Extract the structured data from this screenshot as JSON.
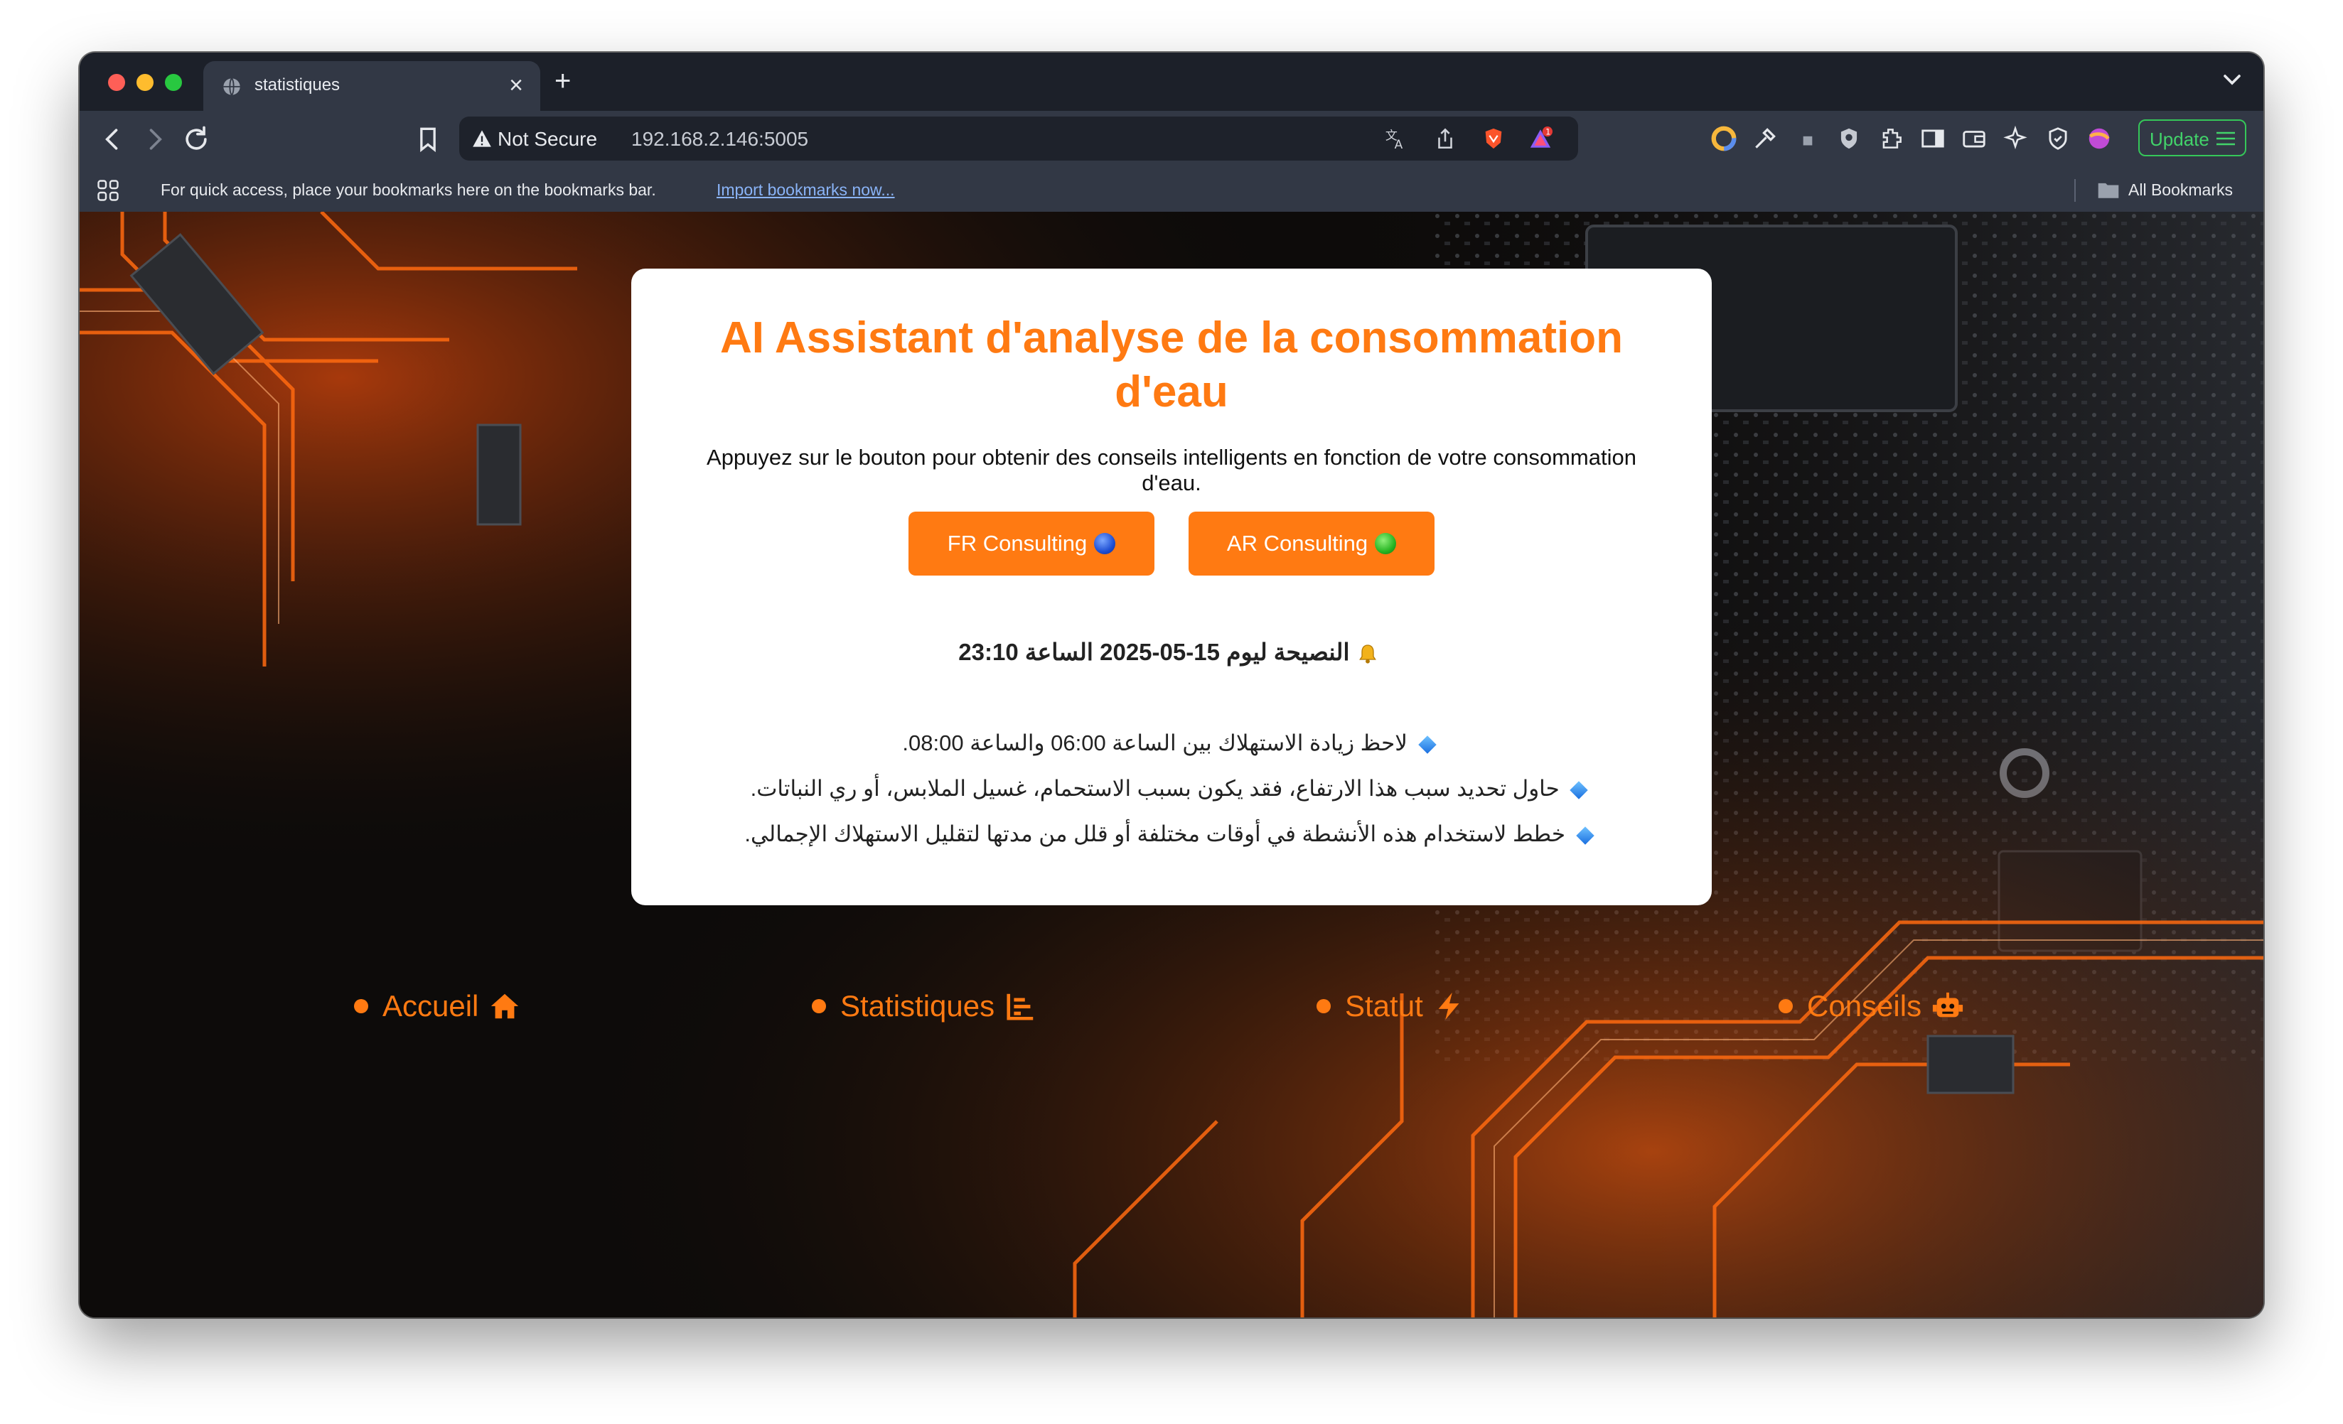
{
  "browser": {
    "tab_title": "statistiques",
    "tab_close": "×",
    "new_tab": "+",
    "security_label": "Not Secure",
    "url": "192.168.2.146:5005",
    "update_label": "Update",
    "extension_badge": "1",
    "bookmarks_hint": "For quick access, place your bookmarks here on the bookmarks bar.",
    "bookmarks_import": "Import bookmarks now...",
    "all_bookmarks": "All Bookmarks"
  },
  "page": {
    "title": "AI Assistant d'analyse de la consommation d'eau",
    "description": "Appuyez sur le bouton pour obtenir des conseils intelligents en fonction de votre consommation d'eau.",
    "buttons": {
      "fr": "FR Consulting",
      "ar": "AR Consulting"
    },
    "advice_title": "النصيحة ليوم 15-05-2025 الساعة 23:10",
    "advice_items": [
      "لاحظ زيادة الاستهلاك بين الساعة 06:00 والساعة 08:00.",
      "حاول تحديد سبب هذا الارتفاع، فقد يكون بسبب الاستحمام، غسيل الملابس، أو ري النباتات.",
      "خطط لاستخدام هذه الأنشطة في أوقات مختلفة أو قلل من مدتها لتقليل الاستهلاك الإجمالي."
    ]
  },
  "nav": {
    "items": [
      {
        "label": "Accueil",
        "icon": "home-icon"
      },
      {
        "label": "Statistiques",
        "icon": "chart-icon"
      },
      {
        "label": "Statut",
        "icon": "bolt-icon"
      },
      {
        "label": "Conseils",
        "icon": "robot-icon"
      }
    ]
  },
  "colors": {
    "accent": "#ff7a12",
    "background": "#0d0b0a",
    "card": "#ffffff"
  }
}
